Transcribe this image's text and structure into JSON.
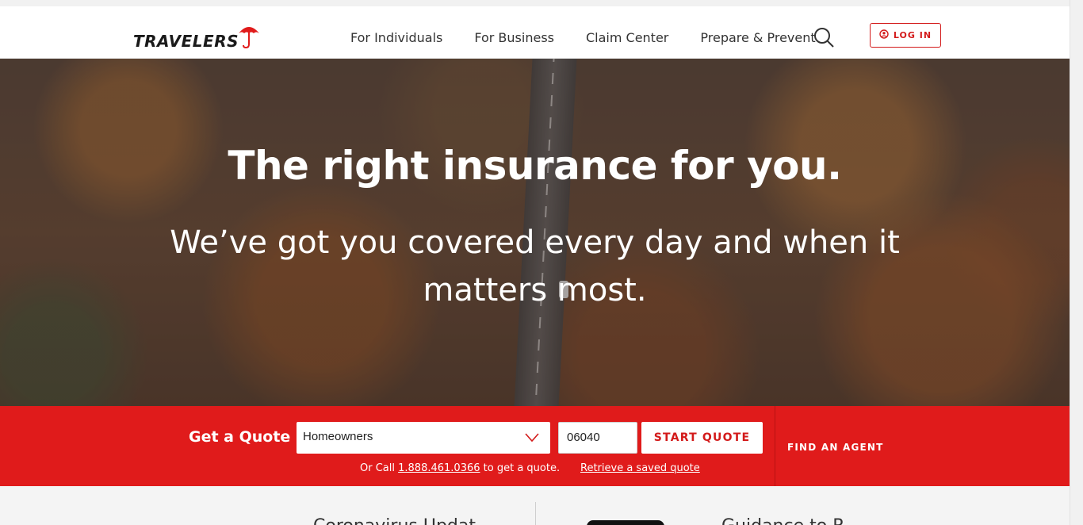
{
  "brand": {
    "name": "TRAVELERS",
    "accent_color": "#e01b1b"
  },
  "nav": {
    "items": [
      {
        "label": "For Individuals"
      },
      {
        "label": "For Business"
      },
      {
        "label": "Claim Center"
      },
      {
        "label": "Prepare & Prevent"
      }
    ],
    "search_icon": "search-icon",
    "login_label": "LOG IN",
    "login_icon": "user-circle-icon"
  },
  "hero": {
    "title": "The right insurance for you.",
    "subtitle": "We’ve got you covered every day and when it matters most."
  },
  "quote": {
    "label": "Get a Quote",
    "product_selected": "Homeowners",
    "zip_value": "06040",
    "start_label": "START QUOTE",
    "call_prefix": "Or Call",
    "phone": "1.888.461.0366",
    "call_suffix": "to get a quote.",
    "retrieve_label": "Retrieve a saved quote",
    "find_agent_label": "FIND AN AGENT"
  },
  "bottom": {
    "left_heading": "Coronavirus Updat",
    "right_heading": "Guidance to R"
  }
}
